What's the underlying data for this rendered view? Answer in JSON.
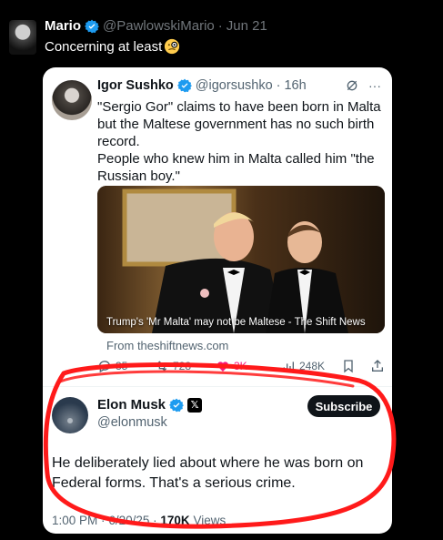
{
  "outer": {
    "name": "Mario",
    "handle": "@PawlowskiMario",
    "dot": "·",
    "date": "Jun 21",
    "text": "Concerning at least"
  },
  "quoted": {
    "name": "Igor Sushko",
    "handle": "@igorsushko",
    "dot": "·",
    "time": "16h",
    "text": "\"Sergio Gor\" claims to have been born in Malta but the Maltese government has no such birth record.\nPeople who knew him in Malta called him \"the Russian boy.\"",
    "media_caption": "Trump's 'Mr Malta' may not be Maltese - The Shift News",
    "from_link": "From theshiftnews.com",
    "actions": {
      "replies": "35",
      "reposts": "728",
      "likes": "3K",
      "views": "248K"
    },
    "tools": {
      "more": "···"
    }
  },
  "reply": {
    "name": "Elon Musk",
    "handle": "@elonmusk",
    "subscribe": "Subscribe",
    "text": "He deliberately lied about where he was born on\nFederal forms. That's a serious crime.",
    "time": "1:00 PM",
    "date": "6/20/25",
    "views_count": "170K",
    "views_label": "Views",
    "dot": "·"
  },
  "colors": {
    "background": "#000000",
    "verified": "#1d9bf0",
    "like": "#f91880",
    "annotation": "#ff1a1a"
  }
}
